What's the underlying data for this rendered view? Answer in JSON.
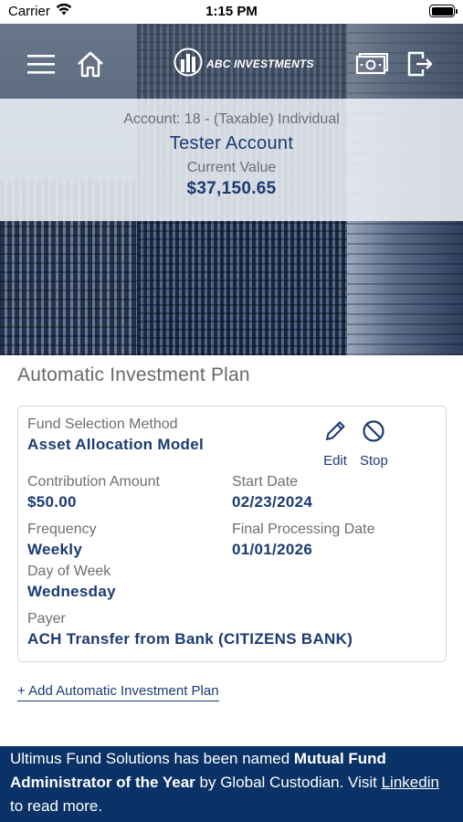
{
  "status_bar": {
    "carrier": "Carrier",
    "time": "1:15 PM",
    "battery_level": 1.0
  },
  "header": {
    "logo_text": "ABC INVESTMENTS",
    "icons": [
      "menu-icon",
      "home-icon",
      "logo-icon",
      "cash-icon",
      "logout-icon"
    ]
  },
  "account": {
    "line": "Account: 18 - (Taxable) Individual",
    "name": "Tester Account",
    "current_value_label": "Current Value",
    "current_value": "$37,150.65"
  },
  "plan": {
    "section_title": "Automatic Investment Plan",
    "fund_selection_label": "Fund Selection Method",
    "fund_selection_value": "Asset Allocation Model",
    "edit_label": "Edit",
    "stop_label": "Stop",
    "contribution_label": "Contribution Amount",
    "contribution_value": "$50.00",
    "start_date_label": "Start Date",
    "start_date_value": "02/23/2024",
    "frequency_label": "Frequency",
    "frequency_value": "Weekly",
    "final_date_label": "Final Processing Date",
    "final_date_value": "01/01/2026",
    "day_label": "Day of Week",
    "day_value": "Wednesday",
    "payer_label": "Payer",
    "payer_value": "ACH Transfer from Bank (CITIZENS BANK)"
  },
  "add_plan_link": "+ Add Automatic Investment Plan",
  "footer": {
    "text_1": "Ultimus Fund Solutions has been named ",
    "bold": "Mutual Fund Administrator of the Year",
    "text_2": " by Global Custodian. Visit ",
    "link": "Linkedin",
    "text_3": " to read more."
  },
  "colors": {
    "brand_navy": "#1b3b72",
    "footer_bg": "#0a3266",
    "muted_text": "#6b6f74"
  }
}
